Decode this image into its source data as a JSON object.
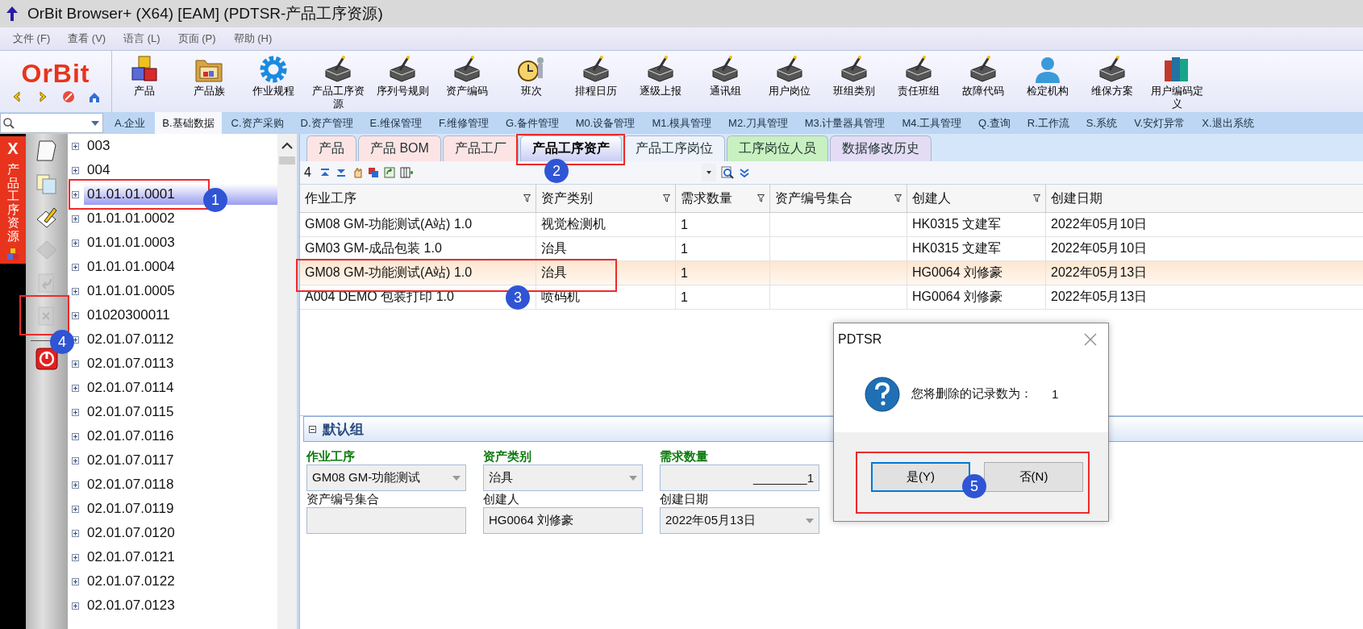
{
  "window": {
    "title": "OrBit Browser+ (X64) [EAM] (PDTSR-产品工序资源)"
  },
  "menu": [
    "文件 (F)",
    "查看 (V)",
    "语言 (L)",
    "页面 (P)",
    "帮助 (H)"
  ],
  "logo": {
    "text": "OrBit"
  },
  "toolbar": [
    {
      "label": "产品",
      "kind": "cubes"
    },
    {
      "label": "产品族",
      "kind": "folder"
    },
    {
      "label": "作业规程",
      "kind": "gear"
    },
    {
      "label": "产品工序资源",
      "kind": "machine"
    },
    {
      "label": "序列号规则",
      "kind": "machine"
    },
    {
      "label": "资产编码",
      "kind": "machine"
    },
    {
      "label": "班次",
      "kind": "clock"
    },
    {
      "label": "排程日历",
      "kind": "machine"
    },
    {
      "label": "逐级上报",
      "kind": "machine"
    },
    {
      "label": "通讯组",
      "kind": "machine"
    },
    {
      "label": "用户岗位",
      "kind": "machine"
    },
    {
      "label": "班组类别",
      "kind": "machine"
    },
    {
      "label": "责任班组",
      "kind": "machine"
    },
    {
      "label": "故障代码",
      "kind": "machine"
    },
    {
      "label": "检定机构",
      "kind": "person"
    },
    {
      "label": "维保方案",
      "kind": "machine"
    },
    {
      "label": "用户编码定义",
      "kind": "books"
    }
  ],
  "modules": [
    {
      "label": "A.企业",
      "selected": false
    },
    {
      "label": "B.基础数据",
      "selected": true
    },
    {
      "label": "C.资产采购",
      "selected": false
    },
    {
      "label": "D.资产管理",
      "selected": false
    },
    {
      "label": "E.维保管理",
      "selected": false
    },
    {
      "label": "F.维修管理",
      "selected": false
    },
    {
      "label": "G.备件管理",
      "selected": false
    },
    {
      "label": "M0.设备管理",
      "selected": false
    },
    {
      "label": "M1.模具管理",
      "selected": false
    },
    {
      "label": "M2.刀具管理",
      "selected": false
    },
    {
      "label": "M3.计量器具管理",
      "selected": false
    },
    {
      "label": "M4.工具管理",
      "selected": false
    },
    {
      "label": "Q.查询",
      "selected": false
    },
    {
      "label": "R.工作流",
      "selected": false
    },
    {
      "label": "S.系统",
      "selected": false
    },
    {
      "label": "V.安灯异常",
      "selected": false
    },
    {
      "label": "X.退出系统",
      "selected": false
    }
  ],
  "side_panel": {
    "title": "产品工序资源",
    "close": "X"
  },
  "side_tools": [
    {
      "kind": "new",
      "disabled": false
    },
    {
      "kind": "copy",
      "disabled": false
    },
    {
      "kind": "edit",
      "disabled": false
    },
    {
      "kind": "grid",
      "disabled": true
    },
    {
      "kind": "undo",
      "disabled": true
    },
    {
      "kind": "delete",
      "disabled": true
    },
    {
      "kind": "power",
      "disabled": false
    }
  ],
  "tree": [
    {
      "label": "003",
      "selected": false
    },
    {
      "label": "004",
      "selected": false
    },
    {
      "label": "01.01.01.0001",
      "selected": true
    },
    {
      "label": "01.01.01.0002",
      "selected": false
    },
    {
      "label": "01.01.01.0003",
      "selected": false
    },
    {
      "label": "01.01.01.0004",
      "selected": false
    },
    {
      "label": "01.01.01.0005",
      "selected": false
    },
    {
      "label": "01020300011",
      "selected": false
    },
    {
      "label": "02.01.07.0112",
      "selected": false
    },
    {
      "label": "02.01.07.0113",
      "selected": false
    },
    {
      "label": "02.01.07.0114",
      "selected": false
    },
    {
      "label": "02.01.07.0115",
      "selected": false
    },
    {
      "label": "02.01.07.0116",
      "selected": false
    },
    {
      "label": "02.01.07.0117",
      "selected": false
    },
    {
      "label": "02.01.07.0118",
      "selected": false
    },
    {
      "label": "02.01.07.0119",
      "selected": false
    },
    {
      "label": "02.01.07.0120",
      "selected": false
    },
    {
      "label": "02.01.07.0121",
      "selected": false
    },
    {
      "label": "02.01.07.0122",
      "selected": false
    },
    {
      "label": "02.01.07.0123",
      "selected": false
    }
  ],
  "tabs": [
    {
      "label": "产品",
      "selected": false,
      "color": "#fde4e4"
    },
    {
      "label": "产品 BOM",
      "selected": false,
      "color": "#fde4e4"
    },
    {
      "label": "产品工厂",
      "selected": false,
      "color": "#fde4e4"
    },
    {
      "label": "产品工序资产",
      "selected": true,
      "color": "#c9cdf5"
    },
    {
      "label": "产品工序岗位",
      "selected": false,
      "color": "#eef2fb"
    },
    {
      "label": "工序岗位人员",
      "selected": false,
      "color": "#c8f0c0"
    },
    {
      "label": "数据修改历史",
      "selected": false,
      "color": "#e4dcf5"
    }
  ],
  "grid_toolbar": {
    "count": "4"
  },
  "table": {
    "columns": [
      "作业工序",
      "资产类别",
      "需求数量",
      "资产编号集合",
      "创建人",
      "创建日期"
    ],
    "rows": [
      {
        "cells": [
          "GM08  GM-功能测试(A站) 1.0",
          "视觉检测机",
          "1",
          "",
          "HK0315 文建军",
          "2022年05月10日"
        ],
        "selected": false
      },
      {
        "cells": [
          "GM03  GM-成品包装 1.0",
          "治具",
          "1",
          "",
          "HK0315 文建军",
          "2022年05月10日"
        ],
        "selected": false
      },
      {
        "cells": [
          "GM08  GM-功能测试(A站) 1.0",
          "治具",
          "1",
          "",
          "HG0064 刘修豪",
          "2022年05月13日"
        ],
        "selected": true
      },
      {
        "cells": [
          "A004 DEMO 包装打印 1.0",
          "喷码机",
          "1",
          "",
          "HG0064 刘修豪",
          "2022年05月13日"
        ],
        "selected": false
      }
    ]
  },
  "group": {
    "title": "默认组"
  },
  "form": [
    {
      "label": "作业工序",
      "value": "GM08  GM-功能测试",
      "required": true,
      "kind": "dropdown"
    },
    {
      "label": "资产类别",
      "value": "治具",
      "required": true,
      "kind": "dropdown"
    },
    {
      "label": "需求数量",
      "value": "________1",
      "required": true,
      "kind": "number"
    },
    {
      "label": "资产编号集合",
      "required": false,
      "kind": "text"
    },
    {
      "label": "创建人",
      "value": "HG0064 刘修豪",
      "required": false,
      "kind": "text"
    },
    {
      "label": "创建日期",
      "value": "2022年05月13日",
      "required": false,
      "kind": "dropdown"
    }
  ],
  "dialog": {
    "title": "PDTSR",
    "message": "您将删除的记录数为：",
    "count": "1",
    "buttons": [
      {
        "label": "是(Y)",
        "focused": true
      },
      {
        "label": "否(N)",
        "focused": false
      }
    ]
  },
  "annotations": [
    {
      "number": "1"
    },
    {
      "number": "2"
    },
    {
      "number": "3"
    },
    {
      "number": "4"
    },
    {
      "number": "5"
    }
  ]
}
